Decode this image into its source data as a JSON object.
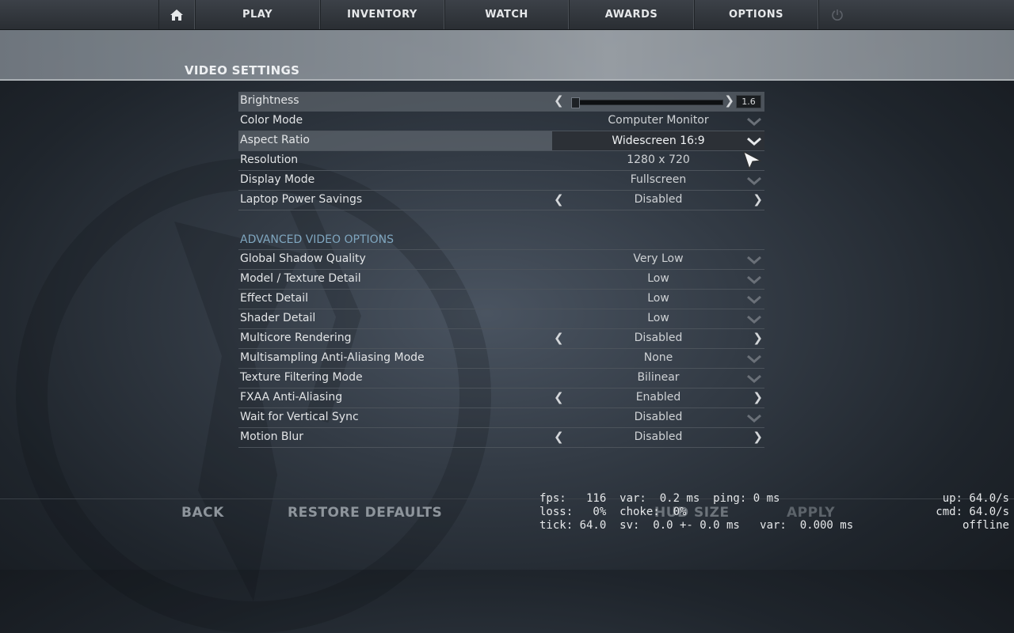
{
  "nav": {
    "items": [
      {
        "label": "PLAY"
      },
      {
        "label": "INVENTORY"
      },
      {
        "label": "WATCH"
      },
      {
        "label": "AWARDS"
      },
      {
        "label": "OPTIONS"
      }
    ],
    "home_icon": "home-icon",
    "power_icon": "power-icon"
  },
  "page": {
    "title": "VIDEO SETTINGS"
  },
  "brightness": {
    "label": "Brightness",
    "value": "1.6",
    "level": 0.02
  },
  "basic_settings": [
    {
      "label": "Color Mode",
      "value": "Computer Monitor"
    },
    {
      "label": "Aspect Ratio",
      "value": "Widescreen 16:9"
    },
    {
      "label": "Resolution",
      "value": "1280 x 720"
    },
    {
      "label": "Display Mode",
      "value": "Fullscreen"
    },
    {
      "label": "Laptop Power Savings",
      "value": "Disabled"
    }
  ],
  "advanced": {
    "title": "ADVANCED VIDEO OPTIONS",
    "settings": [
      {
        "label": "Global Shadow Quality",
        "value": "Very Low"
      },
      {
        "label": "Model / Texture Detail",
        "value": "Low"
      },
      {
        "label": "Effect Detail",
        "value": "Low"
      },
      {
        "label": "Shader Detail",
        "value": "Low"
      },
      {
        "label": "Multicore Rendering",
        "value": "Disabled"
      },
      {
        "label": "Multisampling Anti-Aliasing Mode",
        "value": "None"
      },
      {
        "label": "Texture Filtering Mode",
        "value": "Bilinear"
      },
      {
        "label": "FXAA Anti-Aliasing",
        "value": "Enabled"
      },
      {
        "label": "Wait for Vertical Sync",
        "value": "Disabled"
      },
      {
        "label": "Motion Blur",
        "value": "Disabled"
      }
    ]
  },
  "footer": {
    "back": "BACK",
    "restore": "RESTORE DEFAULTS",
    "hud": "HUD SIZE",
    "apply": "APPLY"
  },
  "netgraph": {
    "line1": "fps:   116  var:  0.2 ms  ping: 0 ms",
    "line2": "loss:   0%  choke:  0%",
    "line3": "tick: 64.0  sv:  0.0 +- 0.0 ms   var:  0.000 ms",
    "right1": "up: 64.0/s",
    "right2": "cmd: 64.0/s",
    "right3": "offline"
  },
  "colors": {
    "section_title": "#7fa6bf",
    "highlight_row": "#6e747c"
  }
}
